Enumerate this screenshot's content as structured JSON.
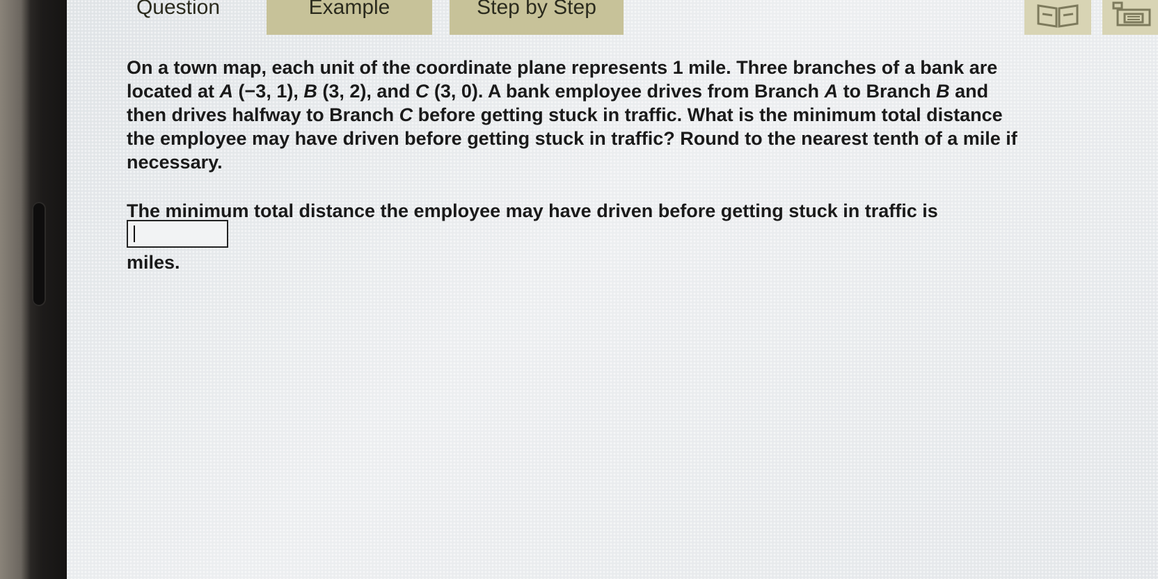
{
  "tabs": {
    "question": "Question",
    "example": "Example",
    "step": "Step by Step"
  },
  "toolbar": {
    "book_icon": "book-icon",
    "print_icon": "print-icon",
    "accent": "#c7c299"
  },
  "question": {
    "line1": "On a town map, each unit of the coordinate plane represents 1 mile. Three branches of a bank are located at ",
    "a_label": "A",
    "a_coords": " (−3, 1), ",
    "b_label": "B",
    "b_coords": " (3, 2), and ",
    "c_label": "C",
    "c_coords": " (3, 0). A bank employee drives from Branch ",
    "a_label2": "A",
    "mid1": " to Branch ",
    "b_label2": "B",
    "mid2": " and then drives halfway to Branch ",
    "c_label2": "C",
    "tail": " before getting stuck in traffic. What is the minimum total distance the employee may have driven before getting stuck in traffic? Round to the nearest tenth of a mile if necessary."
  },
  "answer": {
    "prefix": "The minimum total distance the employee may have driven before getting stuck in traffic is ",
    "value": "",
    "suffix": "miles."
  }
}
